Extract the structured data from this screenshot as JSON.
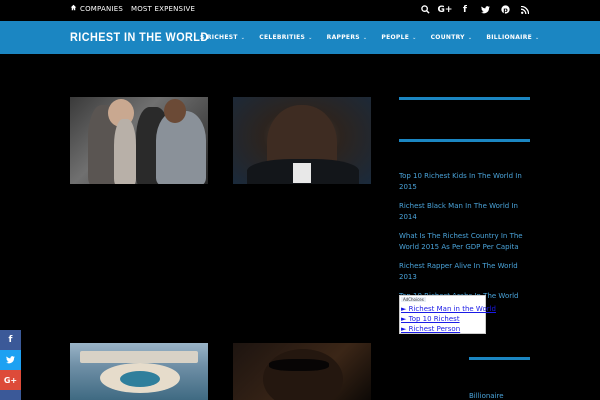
{
  "topbar": {
    "links": [
      {
        "icon": "home-icon",
        "label": "COMPANIES"
      },
      {
        "label": "MOST EXPENSIVE"
      }
    ],
    "social": [
      {
        "name": "search-icon",
        "glyph": "⌕"
      },
      {
        "name": "google-plus-icon",
        "glyph": "G+"
      },
      {
        "name": "facebook-icon",
        "glyph": "f"
      },
      {
        "name": "twitter-icon",
        "glyph": "t"
      },
      {
        "name": "pinterest-icon",
        "glyph": "p"
      },
      {
        "name": "rss-icon",
        "glyph": "≋"
      }
    ]
  },
  "header": {
    "logo": "RICHEST IN THE WORLD",
    "nav": [
      "$ RICHEST",
      "CELEBRITIES",
      "RAPPERS",
      "PEOPLE",
      "COUNTRY",
      "BILLIONAIRE"
    ],
    "caret": "⌄"
  },
  "sidebar": {
    "links": [
      "Top 10 Richest Kids In The World In 2015",
      "Richest Black Man In The World In 2014",
      "What Is The Richest Country In The World 2015 As Per GDP Per Capita",
      "Richest Rapper Alive In The World 2013",
      "Top 10 Richest Arabs In The World 2013"
    ],
    "ad": {
      "choices": "AdChoices",
      "links": [
        "► Richest Man in the World",
        "► Top 10 Richest",
        "► Richest Person"
      ]
    },
    "label": "Billionaire"
  },
  "share": [
    {
      "name": "facebook-share-icon",
      "glyph": "f",
      "color": "#3b5998"
    },
    {
      "name": "twitter-share-icon",
      "glyph": "t",
      "color": "#1da1f2"
    },
    {
      "name": "google-plus-share-icon",
      "glyph": "G+",
      "color": "#dd4b39"
    },
    {
      "name": "share-more-icon",
      "glyph": "",
      "color": "#3b5998"
    }
  ],
  "colors": {
    "accent": "#1b86c2",
    "link": "#4aa3d9"
  }
}
